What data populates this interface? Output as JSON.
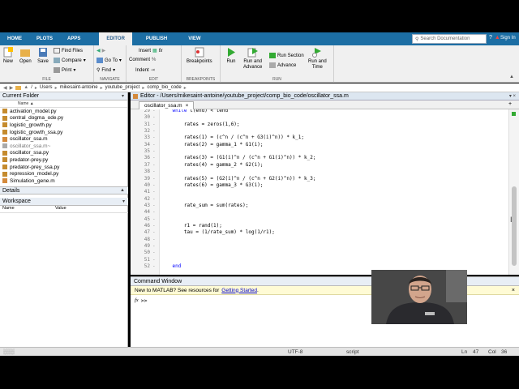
{
  "tabs": [
    "HOME",
    "PLOTS",
    "APPS",
    "EDITOR",
    "PUBLISH",
    "VIEW"
  ],
  "search": {
    "placeholder": "Search Documentation"
  },
  "signin": "Sign In",
  "ribbon": {
    "file": {
      "label": "FILE",
      "new": "New",
      "open": "Open",
      "save": "Save",
      "find_files": "Find Files",
      "compare": "Compare",
      "print": "Print"
    },
    "navigate": {
      "label": "NAVIGATE",
      "go_to": "Go To",
      "find": "Find"
    },
    "edit": {
      "label": "EDIT",
      "insert": "Insert",
      "comment": "Comment",
      "indent": "Indent",
      "fx": "fx"
    },
    "breakpoints": {
      "label": "BREAKPOINTS",
      "button": "Breakpoints"
    },
    "run": {
      "label": "RUN",
      "run": "Run",
      "run_and_advance": "Run and\nAdvance",
      "run_section": "Run Section",
      "advance": "Advance",
      "run_and_time": "Run and\nTime"
    }
  },
  "address": [
    "/",
    "Users",
    "mikesaint-antoine",
    "youtube_project",
    "comp_bio_code"
  ],
  "current_folder": {
    "title": "Current Folder",
    "column": "Name ▲",
    "files": [
      {
        "name": "activation_model.py",
        "type": "py"
      },
      {
        "name": "central_dogma_ode.py",
        "type": "py"
      },
      {
        "name": "logistic_growth.py",
        "type": "py"
      },
      {
        "name": "logistic_growth_ssa.py",
        "type": "py"
      },
      {
        "name": "oscillator_ssa.m",
        "type": "m"
      },
      {
        "name": "oscillator_ssa.m~",
        "type": "tmp"
      },
      {
        "name": "oscillator_ssa.py",
        "type": "py"
      },
      {
        "name": "predator-prey.py",
        "type": "py"
      },
      {
        "name": "predator-prey_ssa.py",
        "type": "py"
      },
      {
        "name": "repression_model.py",
        "type": "py"
      },
      {
        "name": "Simulation_gene.m",
        "type": "m"
      }
    ]
  },
  "details": "Details",
  "workspace": {
    "title": "Workspace",
    "col_name": "Name",
    "col_value": "Value"
  },
  "editor": {
    "title": "Editor - /Users/mikesaint-antoine/youtube_project/comp_bio_code/oscillator_ssa.m",
    "tab": "oscillator_ssa.m",
    "lines": [
      {
        "n": "29",
        "text": "    while t(end) < tend",
        "kw": true
      },
      {
        "n": "30",
        "text": ""
      },
      {
        "n": "31",
        "text": "        rates = zeros(1,6);"
      },
      {
        "n": "32",
        "text": ""
      },
      {
        "n": "33",
        "text": "        rates(1) = (c^n / (c^n + G3(i)^n)) * k_1;"
      },
      {
        "n": "34",
        "text": "        rates(2) = gamma_1 * G1(i);"
      },
      {
        "n": "35",
        "text": ""
      },
      {
        "n": "36",
        "text": "        rates(3) = (G1(i)^n / (c^n + G1(i)^n)) * k_2;"
      },
      {
        "n": "37",
        "text": "        rates(4) = gamma_2 * G2(i);"
      },
      {
        "n": "38",
        "text": ""
      },
      {
        "n": "39",
        "text": "        rates(5) = (G2(i)^n / (c^n + G2(i)^n)) * k_3;"
      },
      {
        "n": "40",
        "text": "        rates(6) = gamma_3 * G3(i);"
      },
      {
        "n": "41",
        "text": ""
      },
      {
        "n": "42",
        "text": ""
      },
      {
        "n": "43",
        "text": "        rate_sum = sum(rates);"
      },
      {
        "n": "44",
        "text": ""
      },
      {
        "n": "45",
        "text": ""
      },
      {
        "n": "46",
        "text": "        r1 = rand(1);"
      },
      {
        "n": "47",
        "text": "        tau = (1/rate_sum) * log(1/r1);"
      },
      {
        "n": "48",
        "text": ""
      },
      {
        "n": "49",
        "text": ""
      },
      {
        "n": "50",
        "text": ""
      },
      {
        "n": "51",
        "text": ""
      },
      {
        "n": "52",
        "text": "    end",
        "kw": true
      }
    ]
  },
  "command_window": {
    "title": "Command Window",
    "info_prefix": "New to MATLAB? See resources for",
    "info_link": "Getting Started",
    "info_suffix": ".",
    "prompt": ">>",
    "fx": "fx"
  },
  "status": {
    "encoding": "UTF-8",
    "type": "script",
    "ln_label": "Ln",
    "ln": "47",
    "col_label": "Col",
    "col": "36"
  },
  "colors": {
    "toolstrip": "#1c6ea4",
    "keyword": "#0000ff"
  }
}
